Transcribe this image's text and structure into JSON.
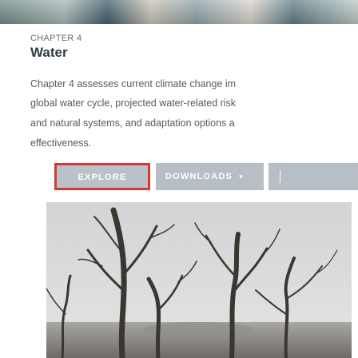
{
  "chapter": {
    "number": "CHAPTER 4",
    "title": "Water",
    "description_lines": [
      "Chapter 4 assesses current climate change im",
      "global water cycle, projected water-related risk",
      "and natural systems, and adaptation options a",
      "effectiveness."
    ]
  },
  "buttons": {
    "explore": "EXPLORE",
    "downloads": "DOWNLOADS",
    "downloads_chevron": "▾"
  },
  "colors": {
    "button_bg": "#b6bec6",
    "highlight_border": "#d23a35",
    "title": "#2e3a40"
  }
}
